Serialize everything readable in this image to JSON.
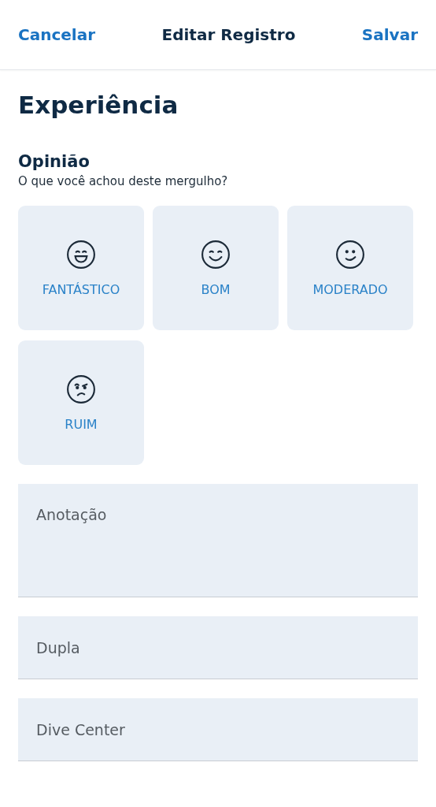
{
  "header": {
    "cancel": "Cancelar",
    "title": "Editar Registro",
    "save": "Salvar"
  },
  "section_title": "Experiência",
  "opinion": {
    "title": "Opinião",
    "subtitle": "O que você achou deste mergulho?",
    "options": [
      {
        "label": "FANTÁSTICO",
        "kind": "grin",
        "selected": false
      },
      {
        "label": "BOM",
        "kind": "smile",
        "selected": false
      },
      {
        "label": "MODERADO",
        "kind": "slight",
        "selected": false
      },
      {
        "label": "RUIM",
        "kind": "frown",
        "selected": false
      }
    ]
  },
  "fields": [
    {
      "placeholder": "Anotação",
      "kind": "multiline"
    },
    {
      "placeholder": "Dupla",
      "kind": "single"
    },
    {
      "placeholder": "Dive Center",
      "kind": "single"
    }
  ]
}
